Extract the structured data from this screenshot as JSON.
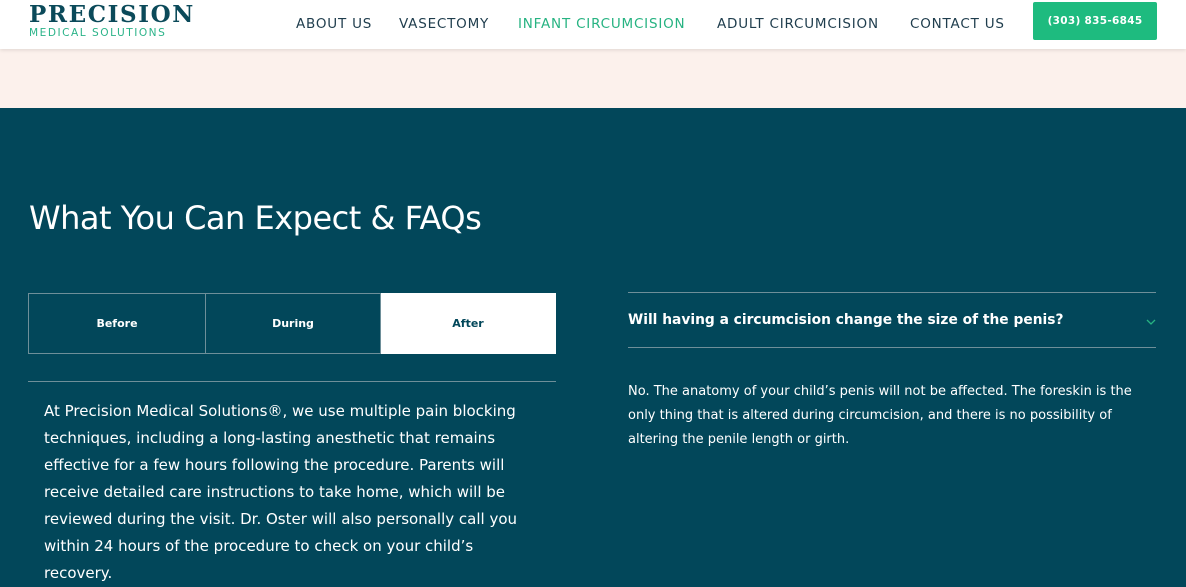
{
  "header": {
    "logo": {
      "line1": "PRECISION",
      "line2": "MEDICAL SOLUTIONS"
    },
    "nav": [
      {
        "label": "ABOUT US",
        "active": false
      },
      {
        "label": "VASECTOMY",
        "active": false
      },
      {
        "label": "INFANT CIRCUMCISION",
        "active": true
      },
      {
        "label": "ADULT CIRCUMCISION",
        "active": false
      },
      {
        "label": "CONTACT US",
        "active": false
      }
    ],
    "phone_button": "(303) 835-6845"
  },
  "section": {
    "title": "What You Can Expect & FAQs",
    "tabs": [
      {
        "label": "Before",
        "selected": false
      },
      {
        "label": "During",
        "selected": false
      },
      {
        "label": "After",
        "selected": true
      }
    ],
    "tab_content": "At Precision Medical Solutions®, we use multiple pain blocking techniques, including a long-lasting anesthetic that remains effective for a few hours following the procedure. Parents will receive detailed care instructions to take home, which will be reviewed during the visit. Dr. Oster will also personally call you within 24 hours of the procedure to check on your child’s recovery."
  },
  "faq": {
    "question": "Will having a circumcision change the size of the penis?",
    "answer": "No. The anatomy of your child’s penis will not be affected. The foreskin is the only thing that is altered during circumcision, and there is no possibility of altering the penile length or girth.",
    "toggle_icon": "chevron-down-icon"
  },
  "colors": {
    "brand_navy": "#0b4a5a",
    "accent_green": "#27b382",
    "button_green": "#1ebb7f",
    "section_bg": "#02475a",
    "peach_band": "#fcf1ec"
  }
}
